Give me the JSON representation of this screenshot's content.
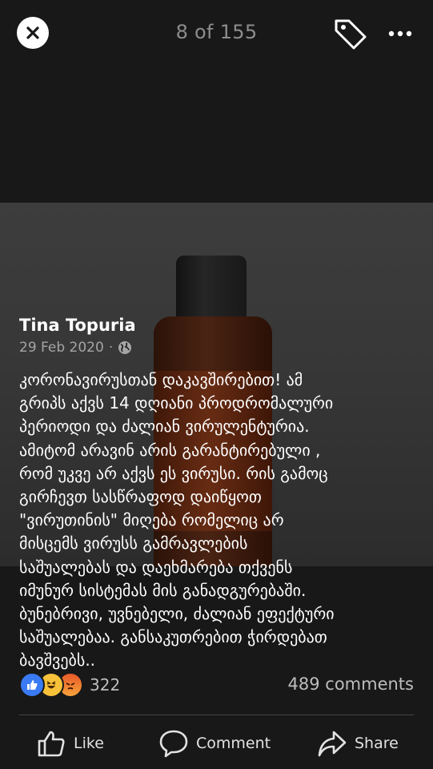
{
  "viewer": {
    "counter": "8 of 155"
  },
  "post": {
    "author": "Tina Topuria",
    "date": "29 Feb 2020",
    "separator": "·",
    "text": "კორონავირუსთან დაკავშირებით! ამ\nგრიპს აქვს 14 დღიანი პროდრომალური\nპერიოდი და ძალიან ვირულენტურია.\nამიტომ  არავინ  არის გარანტირებული ,\n რომ უკვე  არ  აქვს ეს ვირუსი. რის გამოც\nგირჩევთ სასწრაფოდ  დაიწყოთ\n\"ვირუთინის\" მიღება რომელიც არ\nმისცემს ვირუსს გამრავლების\nსაშუალებას და დაეხმარება თქვენს\nიმუნურ სისტემას მის განადგურებაში.\nბუნებრივი, უვნებელი, ძალიან ეფექტური\nსაშუალებაა. განსაკუთრებით ჭირდებათ\nბავშვებს..",
    "audience_icon": "globe-icon"
  },
  "engagement": {
    "reaction_icons": [
      "like-icon",
      "haha-icon",
      "angry-icon"
    ],
    "reaction_count": "322",
    "comments": "489 comments"
  },
  "actions": {
    "like": "Like",
    "comment": "Comment",
    "share": "Share"
  },
  "colors": {
    "background": "#181818",
    "like_blue": "#3a7bf5",
    "haha_yellow": "#f7c23a",
    "angry_orange": "#e8592a"
  }
}
